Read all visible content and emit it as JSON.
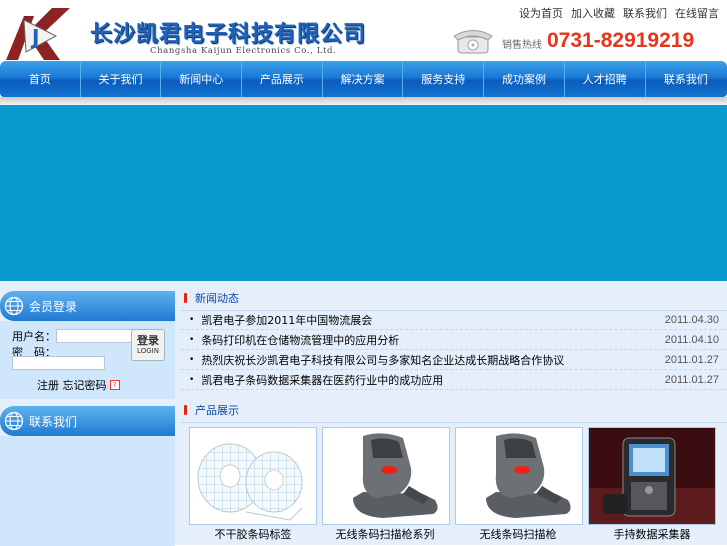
{
  "header": {
    "company_cn": "长沙凯君电子科技有限公司",
    "company_en": "Changsha Kaijun Electronics Co., Ltd.",
    "top_links": [
      "设为首页",
      "加入收藏",
      "联系我们",
      "在线留言"
    ],
    "hotline_label": "销售热线",
    "hotline_number": "0731-82919219",
    "accent_color": "#1f62b8",
    "hotline_color": "#e8341c"
  },
  "nav": {
    "items": [
      "首页",
      "关于我们",
      "新闻中心",
      "产品展示",
      "解决方案",
      "服务支持",
      "成功案例",
      "人才招聘",
      "联系我们"
    ]
  },
  "banner": {
    "color": "#0899cf"
  },
  "sidebar": {
    "member": {
      "title": "会员登录",
      "username_label": "用户名：",
      "password_label": "密　码：",
      "login_button_cn": "登录",
      "login_button_en": "LOGIN",
      "register_text": "注册 忘记密码"
    },
    "contact": {
      "title": "联系我们"
    }
  },
  "news": {
    "title": "新闻动态",
    "items": [
      {
        "title": "凯君电子参加2011年中国物流展会",
        "date": "2011.04.30"
      },
      {
        "title": "条码打印机在仓储物流管理中的应用分析",
        "date": "2011.04.10"
      },
      {
        "title": "热烈庆祝长沙凯君电子科技有限公司与多家知名企业达成长期战略合作协议",
        "date": "2011.01.27"
      },
      {
        "title": "凯君电子条码数据采集器在医药行业中的成功应用",
        "date": "2011.01.27"
      }
    ]
  },
  "products": {
    "title": "产品展示",
    "items": [
      {
        "name": "不干胶条码标签"
      },
      {
        "name": "无线条码扫描枪系列"
      },
      {
        "name": "无线条码扫描枪"
      },
      {
        "name": "手持数据采集器"
      }
    ]
  }
}
